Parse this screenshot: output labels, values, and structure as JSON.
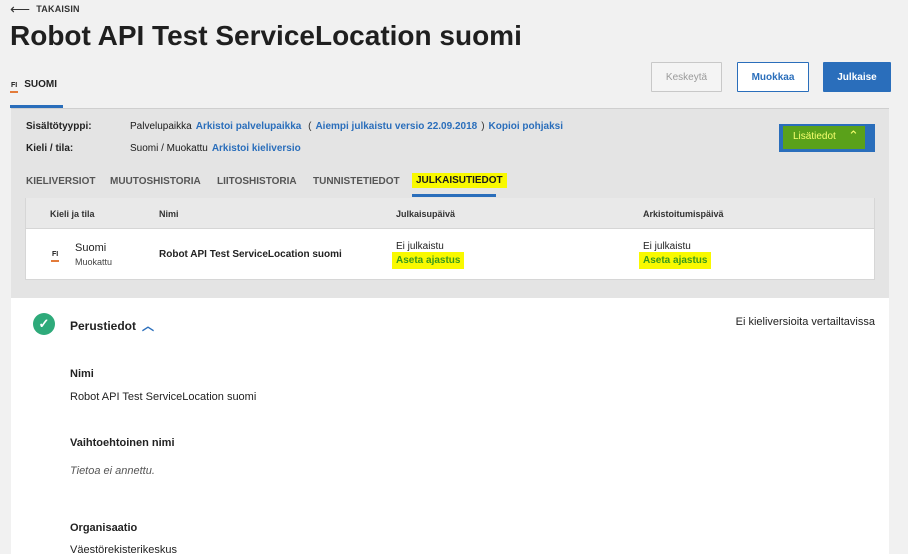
{
  "header": {
    "back_label": "TAKAISIN",
    "title": "Robot API Test ServiceLocation suomi"
  },
  "language_tab": {
    "code": "FI",
    "label": "SUOMI"
  },
  "actions": {
    "cancel_label": "Keskeytä",
    "edit_label": "Muokkaa",
    "publish_label": "Julkaise"
  },
  "meta": {
    "content_type_label": "Sisältötyyppi:",
    "content_type_value": "Palvelupaikka",
    "archive_link": "Arkistoi palvelupaikka",
    "previous_version_link": "Aiempi julkaistu versio 22.09.2018",
    "copy_template_link": "Kopioi pohjaksi",
    "language_state_label": "Kieli / tila:",
    "language_state_value": "Suomi / Muokattu",
    "archive_language_link": "Arkistoi kieliversio",
    "more_info_label": "Lisätiedot"
  },
  "tabs": [
    {
      "label": "KIELIVERSIOT"
    },
    {
      "label": "MUUTOSHISTORIA"
    },
    {
      "label": "LIITOSHISTORIA"
    },
    {
      "label": "TUNNISTETIEDOT"
    },
    {
      "label": "JULKAISUTIEDOT"
    }
  ],
  "table": {
    "headers": [
      "Kieli ja tila",
      "Nimi",
      "Julkaisupäivä",
      "Arkistoitumispäivä"
    ],
    "row": {
      "flag": "FI",
      "language": "Suomi",
      "state": "Muokattu",
      "name": "Robot API Test ServiceLocation suomi",
      "publish_status": "Ei julkaistu",
      "publish_schedule_link": "Aseta ajastus",
      "archive_status": "Ei julkaistu",
      "archive_schedule_link": "Aseta ajastus"
    }
  },
  "section": {
    "title": "Perustiedot",
    "compare_note": "Ei kieliversioita vertailtavissa",
    "fields": [
      {
        "label": "Nimi",
        "value": "Robot API Test ServiceLocation suomi"
      },
      {
        "label": "Vaihtoehtoinen nimi",
        "value": "Tietoa ei annettu."
      },
      {
        "label": "Organisaatio",
        "value": "Väestörekisterikeskus"
      }
    ]
  },
  "colors": {
    "primary": "#2a6ebb",
    "highlight": "#f9f900",
    "success": "#2eaa7a"
  }
}
